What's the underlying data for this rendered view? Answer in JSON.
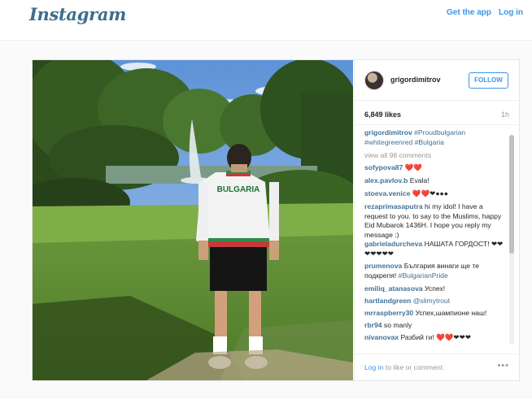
{
  "header": {
    "logo": "Instagram",
    "get_app": "Get the app",
    "login": "Log in"
  },
  "post": {
    "username": "grigordimitrov",
    "follow": "FOLLOW",
    "likes": "6,849 likes",
    "time": "1h",
    "photo_jacket_text": "BULGARIA",
    "caption_user": "grigordimitrov",
    "caption_text": "#Proudbulgarian #whitegreenred #Bulgaria",
    "view_all": "view all 98 comments",
    "comments": [
      {
        "user": "sofypova87",
        "text": "❤️❤️"
      },
      {
        "user": "alex.pavlov.b",
        "text": "Evala!"
      },
      {
        "user": "stoeva.venice",
        "text": "❤️❤️❤●●●"
      },
      {
        "user": "rezaprimasaputra",
        "text": "hi my idol! I have a request to you. to say to the Muslims, happy Eid Mubarok 1436H. I hope you reply my message :)"
      },
      {
        "user": "gabrieladurcheva",
        "text": "НАШАТА ГОРДОСТ! ❤❤❤❤❤❤❤"
      },
      {
        "user": "prumenova",
        "text": "България винаги ще те подкрепя!",
        "tag": "#BulgarianPride"
      },
      {
        "user": "emiliq_atanasova",
        "text": "Успех!"
      },
      {
        "user": "hartlandgreen",
        "tag": "@slimytrout"
      },
      {
        "user": "mrraspberry30",
        "text": "Успех,шампионе наш!"
      },
      {
        "user": "rbr94",
        "text": "so manly"
      },
      {
        "user": "nivanovax",
        "text": "Разбий ги! ❤️❤️❤❤❤"
      }
    ],
    "footer_login": "Log in",
    "footer_text": " to like or comment.",
    "more": "•••"
  },
  "colors": {
    "accent": "#3897f0",
    "username": "#3f729b",
    "logo": "#3e6d8e"
  }
}
